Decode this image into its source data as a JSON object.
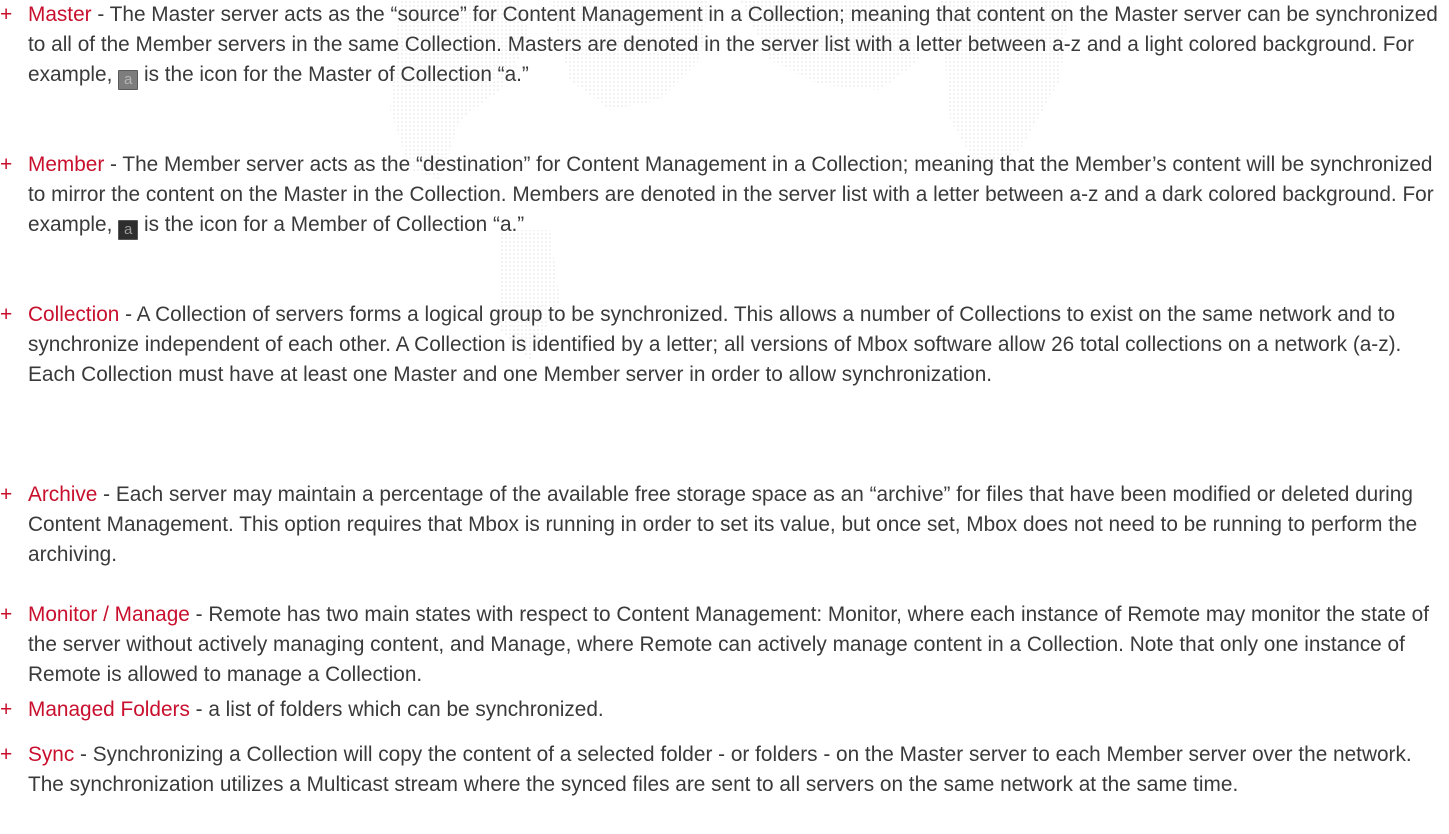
{
  "colors": {
    "bullet": "#c8102e",
    "term": "#c8102e",
    "body_text": "#3a3a3a",
    "master_icon_bg": "#7d7d7d",
    "member_icon_bg": "#2e2e2e"
  },
  "bullet_glyph": "+",
  "entries": [
    {
      "term": "Master",
      "text_a": " - The Master server acts as the “source” for Content Management in a Collection; meaning that content on the Master server can be synchronized to all of the Member servers in the same Collection.  Masters are denoted in the server list with a letter between a-z and a light colored background.  For example, ",
      "icon_letter": "a",
      "icon_name": "master-collection-icon",
      "text_b": " is the icon for the Master of Collection “a.”"
    },
    {
      "term": "Member",
      "text_a": " - The Member server acts as the “destination” for Content Management in a Collection; meaning that the Member’s content will be synchronized to mirror the content on the Master in the Collection.  Members are denoted in the server list with a letter between a-z and a dark colored background.  For example, ",
      "icon_letter": "a",
      "icon_name": "member-collection-icon",
      "text_b": " is the icon for a Member of Collection “a.”"
    },
    {
      "term": "Collection",
      "text_a": " - A Collection of servers forms a logical group to be synchronized. This allows a number of Collections to exist on the same network and to synchronize independent of each other. A Collection is identified by a letter; all versions of Mbox software allow 26 total collections on a network (a-z). Each Collection must have at least one Master and one Member server in order to allow synchronization."
    },
    {
      "term": "Archive",
      "text_a": " - Each server may maintain a percentage of the available free storage space as an “archive” for files that have been modified or deleted during Content Management. This option requires that Mbox is running in order to set its value, but once set, Mbox does not need to be running to perform the archiving."
    },
    {
      "term": "Monitor / Manage",
      "text_a": " - Remote has two main states with respect to Content Management: Monitor, where each instance of Remote may monitor the state of the server without actively managing content, and Manage, where Remote can actively manage content in a Collection. Note that only one instance of Remote is allowed to manage a Collection."
    },
    {
      "term": "Managed Folders",
      "text_a": " - a list of folders which can be synchronized."
    },
    {
      "term": "Sync",
      "text_a": " - Synchronizing a Collection will copy the content of a selected folder - or folders - on the Master server to each Member server over the network. The synchronization utilizes a Multicast stream where the synced files are sent to all servers on the same network at the same time."
    }
  ]
}
